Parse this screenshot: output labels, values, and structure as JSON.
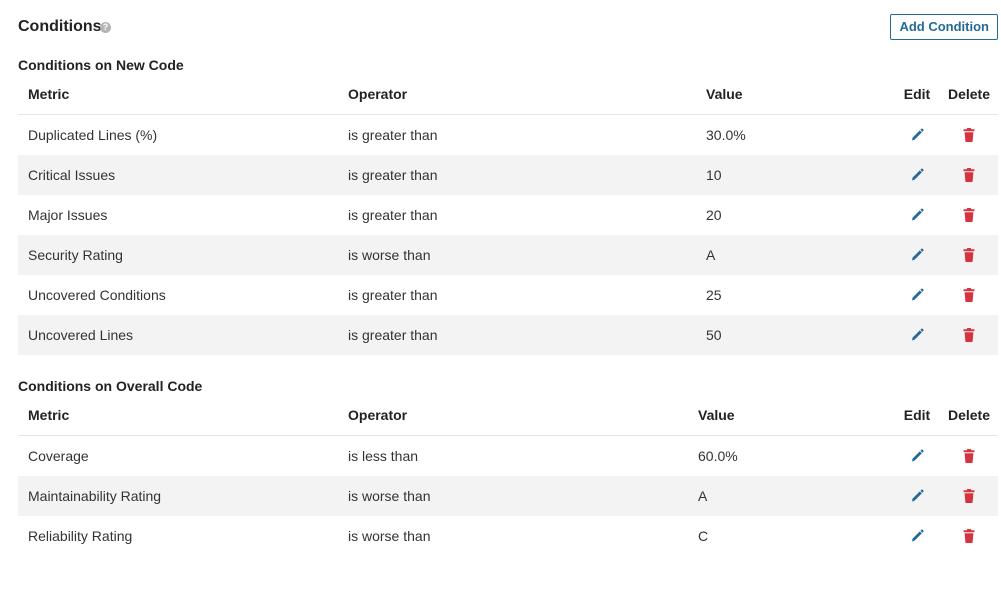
{
  "header": {
    "title": "Conditions",
    "help_icon": "?",
    "add_button": "Add Condition"
  },
  "colors": {
    "accent": "#236a97",
    "delete": "#d4333f",
    "row_alt": "#f3f3f3"
  },
  "columns": {
    "metric": "Metric",
    "operator": "Operator",
    "value": "Value",
    "edit": "Edit",
    "delete": "Delete"
  },
  "new_code": {
    "title": "Conditions on New Code",
    "rows": [
      {
        "metric": "Duplicated Lines (%)",
        "operator": "is greater than",
        "value": "30.0%"
      },
      {
        "metric": "Critical Issues",
        "operator": "is greater than",
        "value": "10"
      },
      {
        "metric": "Major Issues",
        "operator": "is greater than",
        "value": "20"
      },
      {
        "metric": "Security Rating",
        "operator": "is worse than",
        "value": "A"
      },
      {
        "metric": "Uncovered Conditions",
        "operator": "is greater than",
        "value": "25"
      },
      {
        "metric": "Uncovered Lines",
        "operator": "is greater than",
        "value": "50"
      }
    ]
  },
  "overall_code": {
    "title": "Conditions on Overall Code",
    "rows": [
      {
        "metric": "Coverage",
        "operator": "is less than",
        "value": "60.0%"
      },
      {
        "metric": "Maintainability Rating",
        "operator": "is worse than",
        "value": "A"
      },
      {
        "metric": "Reliability Rating",
        "operator": "is worse than",
        "value": "C"
      }
    ]
  }
}
